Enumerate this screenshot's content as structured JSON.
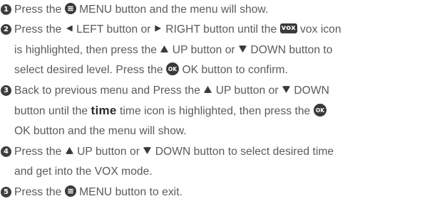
{
  "steps": [
    {
      "number": "1",
      "lines": [
        [
          "Press the ",
          "menu-icon",
          " MENU button and the menu will show."
        ]
      ]
    },
    {
      "number": "2",
      "lines": [
        [
          "Press the ",
          "left-icon",
          " LEFT button or ",
          "right-icon",
          " RIGHT button until the ",
          "vox-icon",
          " vox icon"
        ],
        [
          "is highlighted, then press the ",
          "up-icon",
          " UP button or ",
          "down-icon",
          " DOWN button to"
        ],
        [
          "select desired level. Press the ",
          "ok-icon",
          " OK button to confirm."
        ]
      ]
    },
    {
      "number": "3",
      "lines": [
        [
          "Back to previous menu and Press the ",
          "up-icon",
          " UP button or ",
          "down-icon",
          " DOWN"
        ],
        [
          "button until the  ",
          "time-icon",
          " time icon is highlighted, then press the ",
          "ok-icon"
        ],
        [
          "OK button and the menu will show."
        ]
      ]
    },
    {
      "number": "4",
      "lines": [
        [
          "Press the ",
          "up-icon",
          " UP button or ",
          "down-icon",
          " DOWN button to select desired time"
        ],
        [
          "and get into the VOX mode."
        ]
      ]
    },
    {
      "number": "5",
      "lines": [
        [
          "Press the ",
          "menu-icon",
          " MENU button to exit."
        ]
      ]
    }
  ],
  "icons": {
    "vox_label": "vox",
    "time_label": "time",
    "ok_label": "OK"
  },
  "colors": {
    "text": "#5a5a5a",
    "icon": "#3a3a3a"
  }
}
